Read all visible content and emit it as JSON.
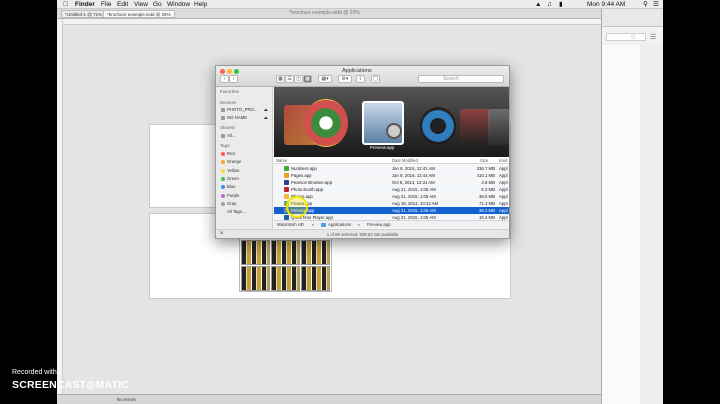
{
  "menubar": {
    "app_name": "Finder",
    "items": [
      "File",
      "Edit",
      "View",
      "Go",
      "Window",
      "Help"
    ],
    "clock": "Mon 9:44 AM"
  },
  "indesign": {
    "tab1": "*Untitled-1 @ 71%",
    "tab2": "*brochure example.indd @ 25%",
    "title_ghost": "*brochure example.indd @ 25%",
    "status": "No errors"
  },
  "finder": {
    "title": "Applications",
    "search_placeholder": "Search",
    "sidebar": {
      "favorites_header": "Favorites",
      "devices_header": "Devices",
      "devices": [
        "PHOTO_PRO...",
        "NO NAME"
      ],
      "shared_header": "Shared",
      "shared": [
        "All..."
      ],
      "tags_header": "Tags",
      "tags": [
        {
          "label": "Red",
          "color": "#ff5a52"
        },
        {
          "label": "Orange",
          "color": "#ffa02b"
        },
        {
          "label": "Yellow",
          "color": "#ffd93b"
        },
        {
          "label": "Green",
          "color": "#3ec54a"
        },
        {
          "label": "Blue",
          "color": "#3b8ff0"
        },
        {
          "label": "Purple",
          "color": "#b86ad8"
        },
        {
          "label": "Gray",
          "color": "#a0a0a0"
        },
        {
          "label": "All Tags...",
          "color": ""
        }
      ]
    },
    "coverflow_label": "Preview.app",
    "columns": {
      "name": "Name",
      "date": "Date Modified",
      "size": "Size",
      "kind": "Kind"
    },
    "rows": [
      {
        "name": "Numbers.app",
        "date": "Jan 8, 2016, 12:41 AM",
        "size": "336.7 MB",
        "kind": "Appl",
        "color": "#3dab3a"
      },
      {
        "name": "Pages.app",
        "date": "Jan 8, 2016, 12:44 AM",
        "size": "410.1 MB",
        "kind": "Appl",
        "color": "#f09a22"
      },
      {
        "name": "Pearson Browser.app",
        "date": "Oct 8, 2013, 12:31 AM",
        "size": "3.8 MB",
        "kind": "Appl",
        "color": "#2a3f8f"
      },
      {
        "name": "Photo Booth.app",
        "date": "Aug 21, 2015, 1:05 AM",
        "size": "6.3 MB",
        "kind": "Appl",
        "color": "#c0262d"
      },
      {
        "name": "Photos.app",
        "date": "Aug 21, 2015, 1:05 AM",
        "size": "38.5 MB",
        "kind": "Appl",
        "color": "#f4b640"
      },
      {
        "name": "Picasa.app",
        "date": "Aug 18, 2014, 10:42 AM",
        "size": "71.4 MB",
        "kind": "Appl",
        "color": "#6aa84f"
      },
      {
        "name": "Preview.app",
        "date": "Aug 21, 2015, 1:05 AM",
        "size": "38.2 MB",
        "kind": "Appl",
        "color": "#6d8fb0"
      },
      {
        "name": "QuickTime Player.app",
        "date": "Aug 21, 2015, 1:05 AM",
        "size": "15.4 MB",
        "kind": "Appl",
        "color": "#1b5fa8"
      }
    ],
    "selected_index": 6,
    "path": [
      "Macintosh HD",
      "Applications",
      "Preview.app"
    ],
    "status": "1 of 89 selected, 939.52 GB available"
  },
  "watermark": {
    "line1": "Recorded with",
    "line2": "SCREENCAST◎MATIC"
  }
}
